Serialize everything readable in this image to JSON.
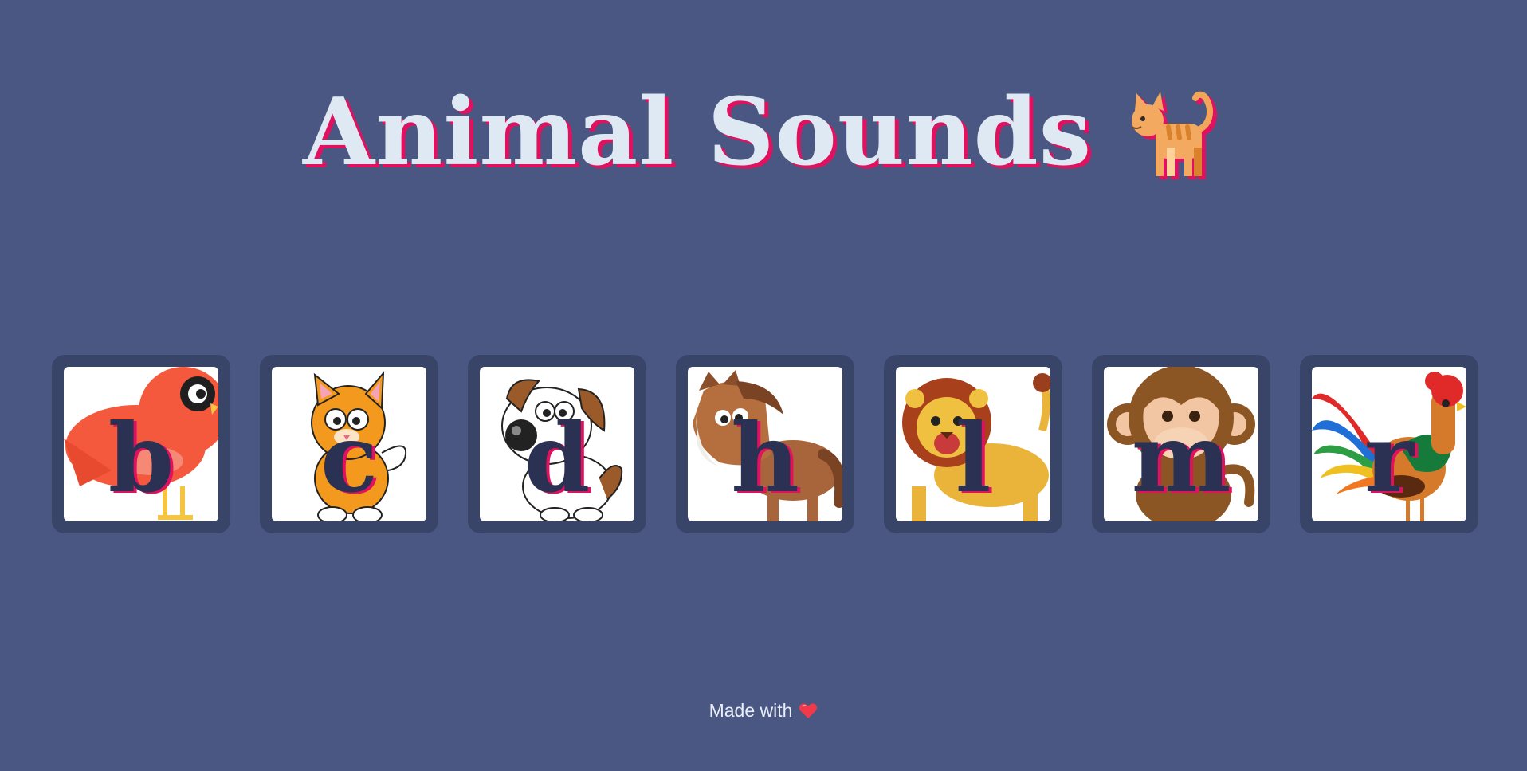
{
  "header": {
    "title": "Animal Sounds",
    "title_icon": "cat-emoji-icon"
  },
  "keys": [
    {
      "letter": "b",
      "animal": "bird",
      "icon": "bird-icon"
    },
    {
      "letter": "c",
      "animal": "cat",
      "icon": "cat-icon"
    },
    {
      "letter": "d",
      "animal": "dog",
      "icon": "dog-icon"
    },
    {
      "letter": "h",
      "animal": "horse",
      "icon": "horse-icon"
    },
    {
      "letter": "l",
      "animal": "lion",
      "icon": "lion-icon"
    },
    {
      "letter": "m",
      "animal": "monkey",
      "icon": "monkey-icon"
    },
    {
      "letter": "r",
      "animal": "rooster",
      "icon": "rooster-icon"
    }
  ],
  "footer": {
    "text": "Made with",
    "icon": "heart-icon"
  },
  "colors": {
    "background": "#4a5783",
    "key_frame": "#394469",
    "title": "#dfe9f3",
    "accent_shadow": "#e0115f",
    "letter": "#2b3152"
  }
}
